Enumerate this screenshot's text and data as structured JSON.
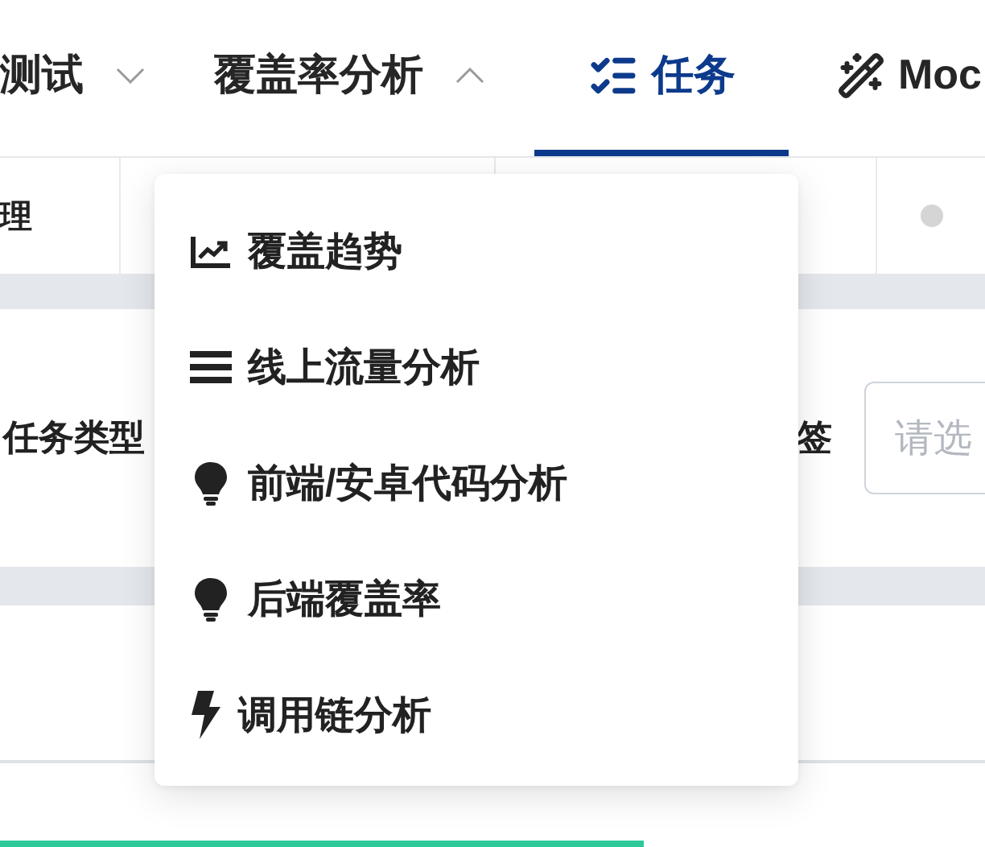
{
  "nav": {
    "items": [
      {
        "label": "测试",
        "kind": "dropdown",
        "expanded": false,
        "selected": false
      },
      {
        "label": "覆盖率分析",
        "kind": "dropdown",
        "expanded": true,
        "selected": false
      },
      {
        "label": "任务",
        "kind": "tasks",
        "selected": true
      },
      {
        "label": "Moc",
        "kind": "mock",
        "selected": false
      }
    ]
  },
  "sub_row": {
    "cell_1": "理"
  },
  "filters": {
    "type_label": "任务类型",
    "tag_label": "签",
    "tag_select": {
      "placeholder": "请选"
    }
  },
  "dropdown_menu": {
    "items": [
      {
        "label": "覆盖趋势",
        "kind": "trend"
      },
      {
        "label": "线上流量分析",
        "kind": "bars"
      },
      {
        "label": "前端/安卓代码分析",
        "kind": "bulb"
      },
      {
        "label": "后端覆盖率",
        "kind": "bulb"
      },
      {
        "label": "调用链分析",
        "kind": "bolt"
      }
    ]
  }
}
